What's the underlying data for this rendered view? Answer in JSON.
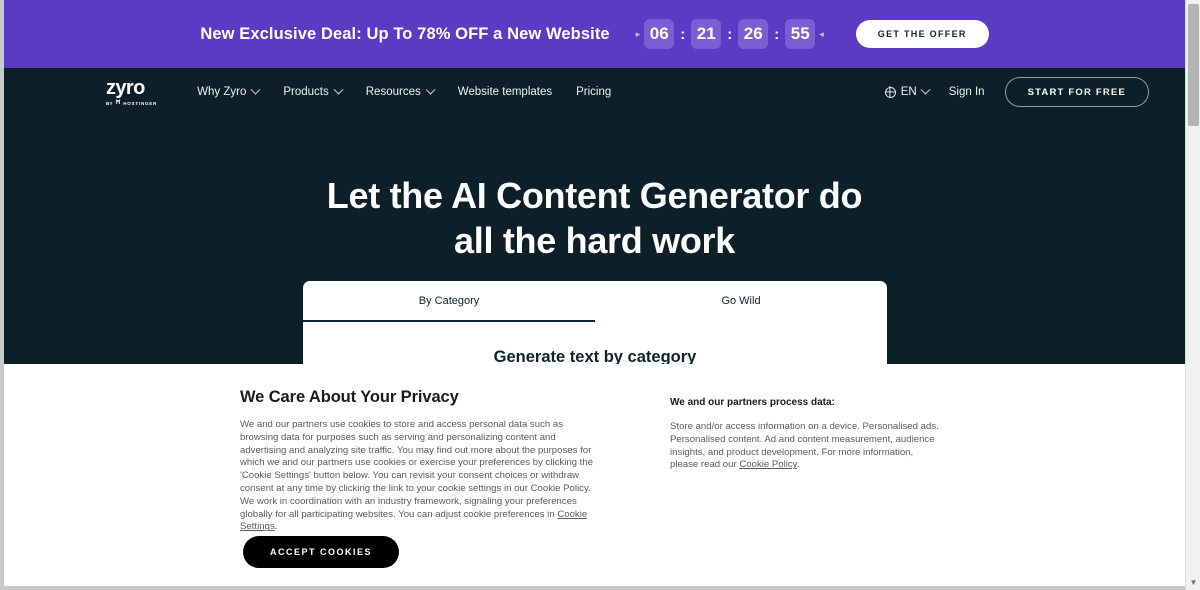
{
  "promo": {
    "text": "New Exclusive Deal: Up To 78% OFF a New Website",
    "countdown": {
      "left_caret": "▸",
      "right_caret": "◂",
      "separator": ":",
      "units": [
        "06",
        "21",
        "26",
        "55"
      ]
    },
    "cta_label": "GET THE OFFER",
    "background": "#5B3AC4",
    "box_background": "#7A5FD4"
  },
  "nav": {
    "logo": {
      "word": "zyro",
      "by": "BY",
      "mark": "Ħ",
      "brand": "HOSTINGER"
    },
    "links": [
      {
        "label": "Why Zyro",
        "has_chevron": true
      },
      {
        "label": "Products",
        "has_chevron": true
      },
      {
        "label": "Resources",
        "has_chevron": true
      },
      {
        "label": "Website templates",
        "has_chevron": false
      },
      {
        "label": "Pricing",
        "has_chevron": false
      }
    ],
    "language": {
      "icon": "globe-icon",
      "label": "EN"
    },
    "sign_in": "Sign In",
    "start_free": "START FOR FREE",
    "background": "#0D2029"
  },
  "hero": {
    "title_line1": "Let the AI Content Generator do",
    "title_line2": "all the hard work"
  },
  "generator": {
    "tabs": [
      {
        "label": "By Category",
        "active": true
      },
      {
        "label": "Go Wild",
        "active": false
      }
    ],
    "subtitle": "Generate text by category"
  },
  "cookie": {
    "title": "We Care About Your Privacy",
    "body": "We and our partners use cookies to store and access personal data such as browsing data for purposes such as serving and personalizing content and advertising and analyzing site traffic. You may find out more about the purposes for which we and our partners use cookies or exercise your preferences by clicking the 'Cookie Settings' button below. You can revisit your consent choices or withdraw consent at any time by clicking the link to your cookie settings in our Cookie Policy. We work in coordination with an industry framework, signaling your preferences globally for all participating websites. You can adjust cookie preferences in ",
    "body_link": "Cookie Settings",
    "body_tail": ".",
    "partners_title": "We and our partners process data:",
    "partners_body": "Store and/or access information on a device. Personalised ads. Personalised content. Ad and content measurement, audience insights, and product development. For more information, please read our ",
    "partners_link": "Cookie Policy",
    "partners_tail": ".",
    "accept_label": "ACCEPT COOKIES"
  },
  "scrollbar": {
    "up_arrow": "▲",
    "down_arrow": "▼"
  }
}
